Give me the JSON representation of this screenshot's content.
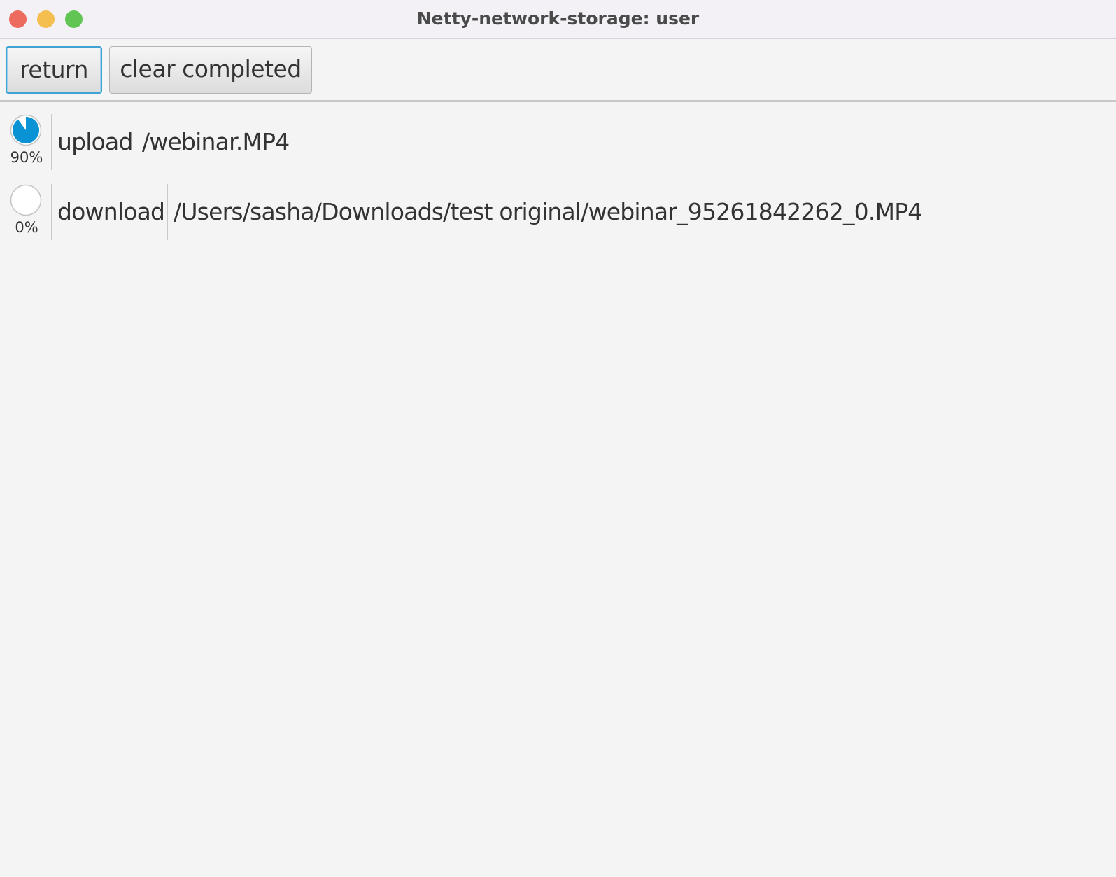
{
  "window": {
    "title": "Netty-network-storage: user",
    "traffic_lights": {
      "close_color": "#ed6a5e",
      "minimize_color": "#f5bf4f",
      "zoom_color": "#61c554"
    }
  },
  "toolbar": {
    "return_label": "return",
    "clear_label": "clear completed"
  },
  "transfers": [
    {
      "progress": 0.9,
      "progress_label": "90%",
      "direction": "upload",
      "path": "/webinar.MP4"
    },
    {
      "progress": 0.0,
      "progress_label": "0%",
      "direction": "download",
      "path": "/Users/sasha/Downloads/test original/webinar_95261842262_0.MP4"
    }
  ],
  "colors": {
    "progress_fill": "#0a93d4",
    "focus_ring": "#3fa3d6"
  }
}
